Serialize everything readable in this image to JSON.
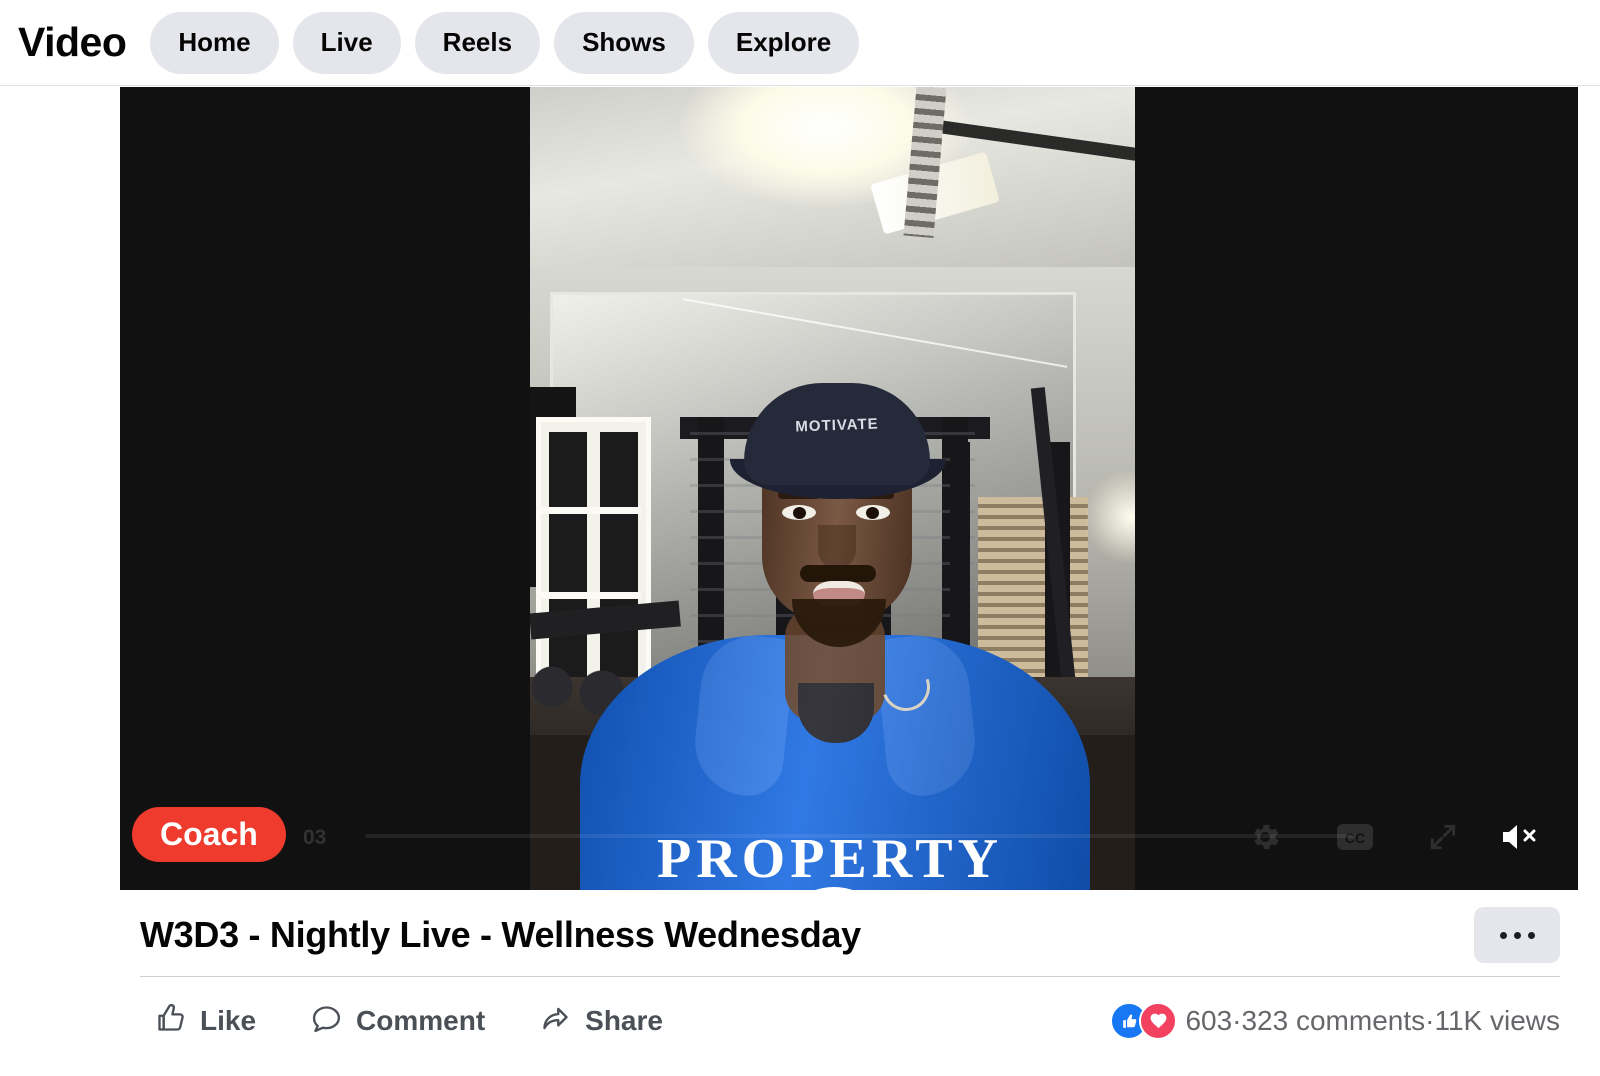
{
  "header": {
    "brand": "Video",
    "nav": [
      {
        "label": "Home",
        "name": "nav-home"
      },
      {
        "label": "Live",
        "name": "nav-live"
      },
      {
        "label": "Reels",
        "name": "nav-reels"
      },
      {
        "label": "Shows",
        "name": "nav-shows"
      },
      {
        "label": "Explore",
        "name": "nav-explore"
      }
    ]
  },
  "player": {
    "badge": "Coach",
    "time_elapsed": "03",
    "controls": {
      "settings": "gear-icon",
      "captions": "CC",
      "fullscreen": "expand-icon",
      "volume": "volume-muted-icon"
    },
    "scene": {
      "cap_text": "MOTIVATE",
      "hoodie_text": "PROPERTY"
    }
  },
  "post": {
    "title": "W3D3 - Nightly Live - Wellness Wednesday",
    "more_menu": "···",
    "actions": [
      {
        "label": "Like",
        "name": "like-button"
      },
      {
        "label": "Comment",
        "name": "comment-button"
      },
      {
        "label": "Share",
        "name": "share-button"
      }
    ],
    "stats": {
      "reactions": "603",
      "sep1": " · ",
      "comments": "323 comments",
      "sep2": " · ",
      "views": "11K views"
    }
  },
  "colors": {
    "pill_bg": "#e4e6eb",
    "badge_red": "#ef3b2d",
    "like_blue": "#1877f2",
    "love_red": "#f3425f",
    "text_dark": "#050505",
    "text_muted": "#65676b"
  }
}
